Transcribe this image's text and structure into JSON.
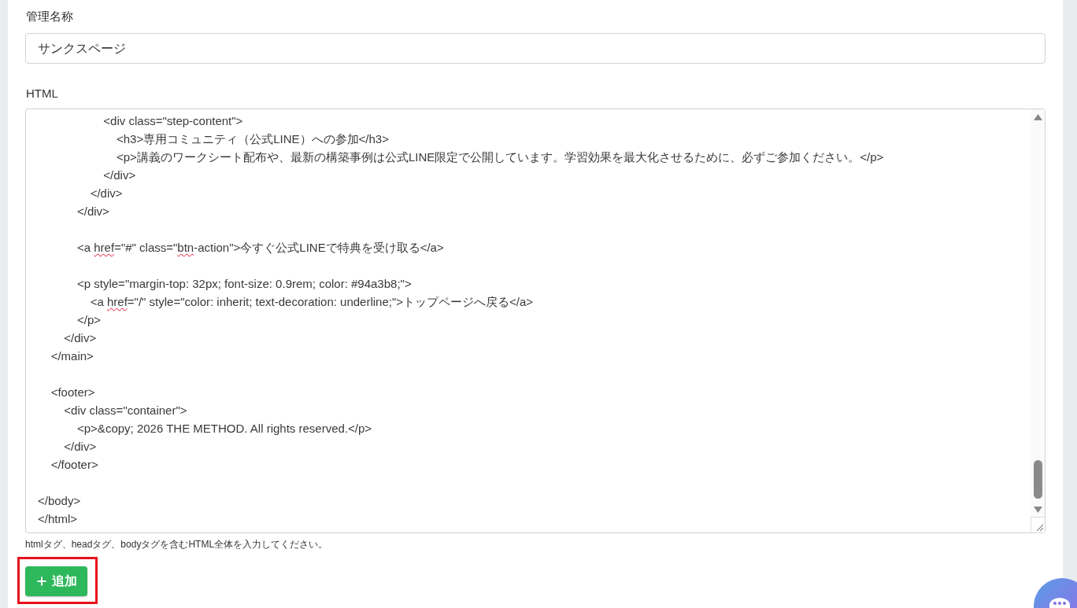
{
  "name_field": {
    "label": "管理名称",
    "value": "サンクスページ"
  },
  "html_field": {
    "label": "HTML",
    "code_blocks": [
      {
        "lines": [
          {
            "parts": [
              {
                "text": "                    <div class=\"step-content\">",
                "misspelled": false
              }
            ]
          },
          {
            "parts": [
              {
                "text": "                        <h3>専用コミュニティ（公式LINE）への参加</h3>",
                "misspelled": false
              }
            ]
          },
          {
            "parts": [
              {
                "text": "                        <p>講義のワークシート配布や、最新の構築事例は公式LINE限定で公開しています。学習効果を最大化させるために、必ずご参加ください。</p>",
                "misspelled": false
              }
            ]
          },
          {
            "parts": [
              {
                "text": "                    </div>",
                "misspelled": false
              }
            ]
          },
          {
            "parts": [
              {
                "text": "                </div>",
                "misspelled": false
              }
            ]
          },
          {
            "parts": [
              {
                "text": "            </div>",
                "misspelled": false
              }
            ]
          }
        ]
      },
      {
        "lines": [
          {
            "parts": [
              {
                "text": "            <a ",
                "misspelled": false
              },
              {
                "text": "href",
                "misspelled": true
              },
              {
                "text": "=\"#\" class=\"",
                "misspelled": false
              },
              {
                "text": "btn",
                "misspelled": true
              },
              {
                "text": "-action\">今すぐ公式LINEで特典を受け取る</a>",
                "misspelled": false
              }
            ]
          }
        ]
      },
      {
        "lines": [
          {
            "parts": [
              {
                "text": "            <p style=\"margin-top: 32px; font-size: 0.9rem; color: #94a3b8;\">",
                "misspelled": false
              }
            ]
          },
          {
            "parts": [
              {
                "text": "                <a ",
                "misspelled": false
              },
              {
                "text": "href",
                "misspelled": true
              },
              {
                "text": "=\"/\" style=\"color: inherit; text-decoration: underline;\">トップページへ戻る</a>",
                "misspelled": false
              }
            ]
          },
          {
            "parts": [
              {
                "text": "            </p>",
                "misspelled": false
              }
            ]
          },
          {
            "parts": [
              {
                "text": "        </div>",
                "misspelled": false
              }
            ]
          },
          {
            "parts": [
              {
                "text": "    </main>",
                "misspelled": false
              }
            ]
          }
        ]
      },
      {
        "lines": [
          {
            "parts": [
              {
                "text": "    <footer>",
                "misspelled": false
              }
            ]
          },
          {
            "parts": [
              {
                "text": "        <div class=\"container\">",
                "misspelled": false
              }
            ]
          },
          {
            "parts": [
              {
                "text": "            <p>&copy; 2026 THE METHOD. All rights reserved.</p>",
                "misspelled": false
              }
            ]
          },
          {
            "parts": [
              {
                "text": "        </div>",
                "misspelled": false
              }
            ]
          },
          {
            "parts": [
              {
                "text": "    </footer>",
                "misspelled": false
              }
            ]
          }
        ]
      },
      {
        "lines": [
          {
            "parts": [
              {
                "text": "</body>",
                "misspelled": false
              }
            ]
          },
          {
            "parts": [
              {
                "text": "</html>",
                "misspelled": false
              }
            ]
          }
        ]
      }
    ],
    "hint": "htmlタグ、headタグ、bodyタグを含むHTML全体を入力してください。"
  },
  "add_button": {
    "label": "追加",
    "highlighted": true
  }
}
